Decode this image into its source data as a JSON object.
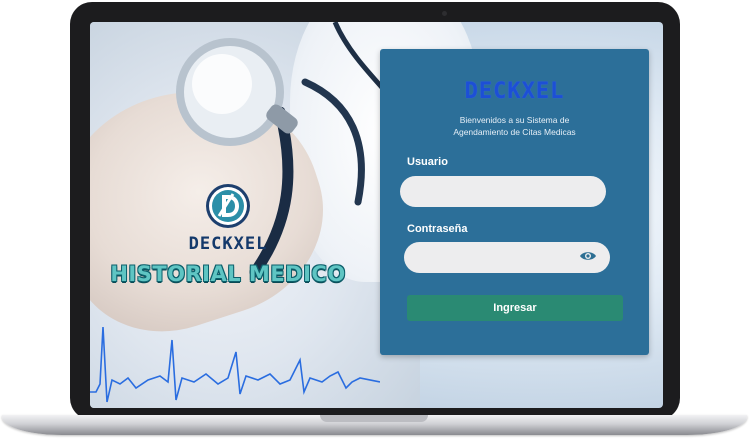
{
  "branding": {
    "left_logo_text": "DECKXEL",
    "title": "HISTORIAL MEDICO",
    "card_logo_text": "DECKXEL"
  },
  "login": {
    "welcome_line1": "Bienvenidos a su Sistema de",
    "welcome_line2": "Agendamiento de Citas Medicas",
    "username_label": "Usuario",
    "username_value": "",
    "password_label": "Contraseña",
    "password_value": "",
    "submit_label": "Ingresar"
  },
  "colors": {
    "card_bg": "#2c6f99",
    "button_bg": "#2a8a73",
    "input_bg": "#ededee",
    "title_teal": "#5fc5c3",
    "logo_blue": "#1d4fd6",
    "ecg_blue": "#2a6de0"
  },
  "icons": {
    "password_toggle": "eye-icon",
    "logo": "d-badge-logo-icon"
  }
}
